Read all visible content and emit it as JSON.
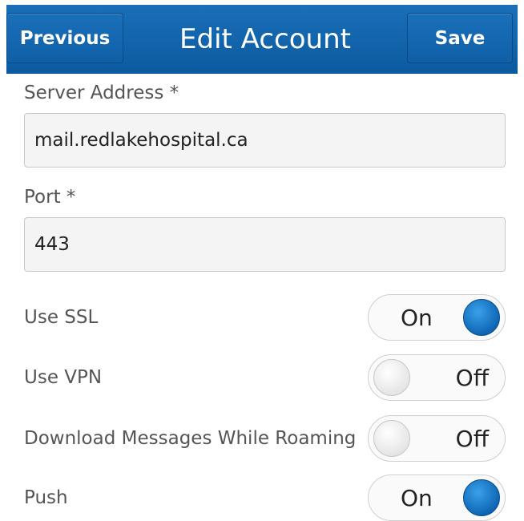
{
  "header": {
    "previous_label": "Previous",
    "title": "Edit Account",
    "save_label": "Save"
  },
  "form": {
    "server_address": {
      "label": "Server Address *",
      "value": "mail.redlakehospital.ca"
    },
    "port": {
      "label": "Port *",
      "value": "443"
    }
  },
  "settings": [
    {
      "label": "Use SSL",
      "state": "On"
    },
    {
      "label": "Use VPN",
      "state": "Off"
    },
    {
      "label": "Download Messages While Roaming",
      "state": "Off"
    },
    {
      "label": "Push",
      "state": "On"
    }
  ],
  "colors": {
    "titlebar": "#0b5aa0",
    "toggle_on_knob": "#0b62b0"
  }
}
